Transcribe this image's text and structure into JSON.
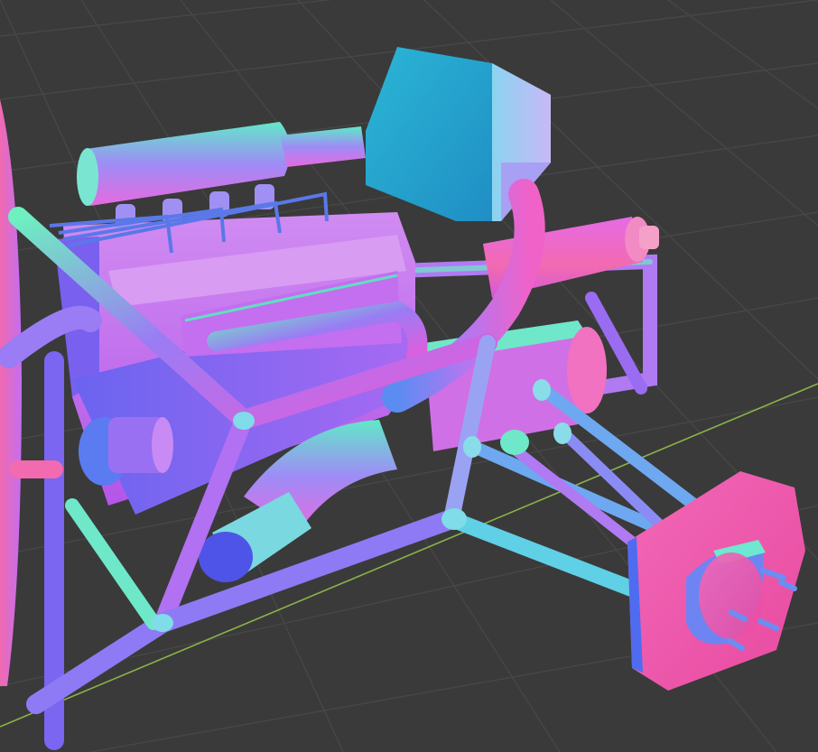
{
  "viewport": {
    "kind": "3d-viewport",
    "shading": "normal-map",
    "background_color": "#3a3a3a",
    "grid_color": "#4a4a4a",
    "x_axis_color": "#8ab34a",
    "colors": {
      "magenta": "#e85ad9",
      "violet": "#9a6cf2",
      "blue": "#4f6cf0",
      "cyan": "#44c7e8",
      "teal": "#2aa8c8",
      "green": "#6ef0b0",
      "pink": "#f06ab0",
      "lavender": "#c8a0f8"
    }
  },
  "model": {
    "name": "engine-chassis-assembly",
    "parts": [
      "frame",
      "engine-block",
      "air-intake",
      "exhaust-pipes",
      "muffler",
      "wheel-hub",
      "suspension-arms"
    ]
  }
}
